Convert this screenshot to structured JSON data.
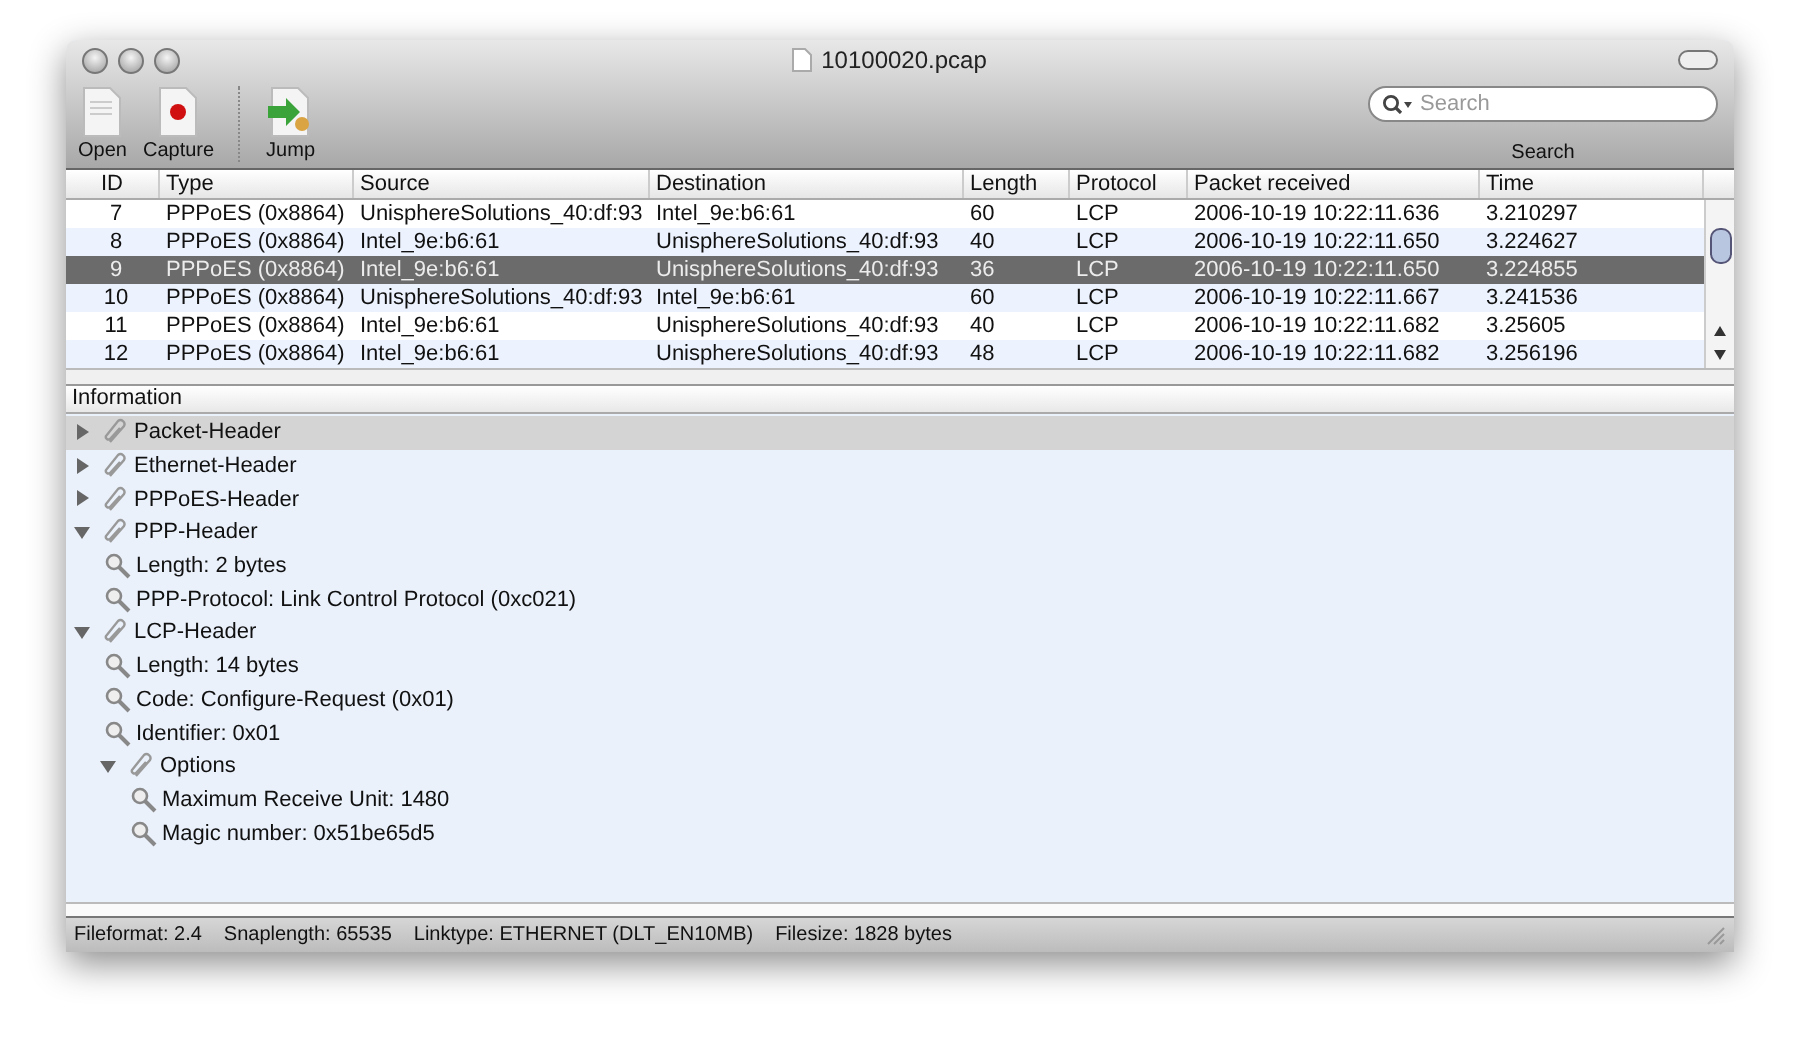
{
  "window": {
    "title": "10100020.pcap"
  },
  "toolbar": {
    "buttons": [
      {
        "kind": "open",
        "label": "Open"
      },
      {
        "kind": "capture",
        "label": "Capture"
      },
      {
        "kind": "jump",
        "label": "Jump"
      }
    ],
    "search": {
      "placeholder": "Search",
      "label": "Search"
    }
  },
  "table": {
    "columns": [
      "ID",
      "Type",
      "Source",
      "Destination",
      "Length",
      "Protocol",
      "Packet received",
      "Time"
    ],
    "rows": [
      {
        "cells": [
          "7",
          "PPPoES (0x8864)",
          "UnisphereSolutions_40:df:93",
          "Intel_9e:b6:61",
          "60",
          "LCP",
          "2006-10-19 10:22:11.636",
          "3.210297"
        ],
        "selected": false
      },
      {
        "cells": [
          "8",
          "PPPoES (0x8864)",
          "Intel_9e:b6:61",
          "UnisphereSolutions_40:df:93",
          "40",
          "LCP",
          "2006-10-19 10:22:11.650",
          "3.224627"
        ],
        "selected": false
      },
      {
        "cells": [
          "9",
          "PPPoES (0x8864)",
          "Intel_9e:b6:61",
          "UnisphereSolutions_40:df:93",
          "36",
          "LCP",
          "2006-10-19 10:22:11.650",
          "3.224855"
        ],
        "selected": true
      },
      {
        "cells": [
          "10",
          "PPPoES (0x8864)",
          "UnisphereSolutions_40:df:93",
          "Intel_9e:b6:61",
          "60",
          "LCP",
          "2006-10-19 10:22:11.667",
          "3.241536"
        ],
        "selected": false
      },
      {
        "cells": [
          "11",
          "PPPoES (0x8864)",
          "Intel_9e:b6:61",
          "UnisphereSolutions_40:df:93",
          "40",
          "LCP",
          "2006-10-19 10:22:11.682",
          "3.25605"
        ],
        "selected": false
      },
      {
        "cells": [
          "12",
          "PPPoES (0x8864)",
          "Intel_9e:b6:61",
          "UnisphereSolutions_40:df:93",
          "48",
          "LCP",
          "2006-10-19 10:22:11.682",
          "3.256196"
        ],
        "selected": false
      }
    ]
  },
  "information": {
    "header": "Information",
    "tree": [
      {
        "kind": "group",
        "label": "Packet-Header",
        "expanded": false,
        "selected": true
      },
      {
        "kind": "group",
        "label": "Ethernet-Header",
        "expanded": false,
        "selected": false
      },
      {
        "kind": "group",
        "label": "PPPoES-Header",
        "expanded": false,
        "selected": false
      },
      {
        "kind": "group",
        "label": "PPP-Header",
        "expanded": true,
        "selected": false,
        "children": [
          {
            "kind": "field",
            "label": "Length: 2 bytes",
            "selected": false
          },
          {
            "kind": "field",
            "label": "PPP-Protocol: Link Control Protocol (0xc021)",
            "selected": false
          }
        ]
      },
      {
        "kind": "group",
        "label": "LCP-Header",
        "expanded": true,
        "selected": false,
        "children": [
          {
            "kind": "field",
            "label": "Length: 14 bytes",
            "selected": false
          },
          {
            "kind": "field",
            "label": "Code: Configure-Request (0x01)",
            "selected": false
          },
          {
            "kind": "field",
            "label": "Identifier: 0x01",
            "selected": false
          },
          {
            "kind": "group",
            "label": "Options",
            "expanded": true,
            "selected": false,
            "children": [
              {
                "kind": "field",
                "label": "Maximum Receive Unit: 1480",
                "selected": false
              },
              {
                "kind": "field",
                "label": "Magic number: 0x51be65d5",
                "selected": false
              }
            ]
          }
        ]
      }
    ]
  },
  "status_bar": [
    "Fileformat: 2.4",
    "Snaplength: 65535",
    "Linktype: ETHERNET (DLT_EN10MB)",
    "Filesize: 1828 bytes"
  ]
}
